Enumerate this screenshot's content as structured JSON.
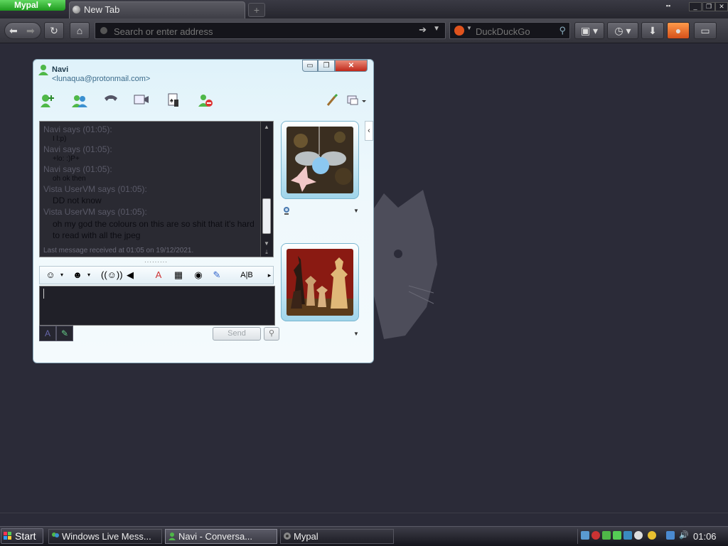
{
  "browser": {
    "app_menu_label": "Mypal",
    "tab_title": "New Tab",
    "new_tab_symbol": "+",
    "address_placeholder": "Search or enter address",
    "search_engine": "DuckDuckGo",
    "icons": [
      "back-icon",
      "forward-icon",
      "reload-icon",
      "home-icon",
      "bookmarks-icon",
      "history-icon",
      "download-icon",
      "firefox-icon",
      "addon-icon"
    ]
  },
  "messenger": {
    "contact_name": "Navi",
    "contact_email": "<lunaqua@protonmail.com>",
    "action_icons": [
      "add-contact-icon",
      "invite-icon",
      "call-icon",
      "video-icon",
      "games-icon",
      "block-icon",
      "paint-icon",
      "display-options-icon"
    ],
    "conversation": [
      {
        "sender": "Navi says (01:05):",
        "text": "I l:p)",
        "small": true
      },
      {
        "sender": "Navi says (01:05):",
        "text": "+lo: :)P+",
        "small": true
      },
      {
        "sender": "Navi says (01:05):",
        "text": "oh ok then",
        "small": true
      },
      {
        "sender": "Vista UserVM says (01:05):",
        "text": "DD not know",
        "small": false
      },
      {
        "sender": "Vista UserVM says (01:05):",
        "text": "oh my god the colours on this are so shit that it's hard to read with all the jpeg",
        "small": false
      }
    ],
    "last_message_status": "Last message received at 01:05 on 19/12/2021.",
    "format_icons": [
      "emoticon-icon",
      "wink-icon",
      "nudge-icon",
      "voice-clip-icon",
      "font-icon",
      "background-icon",
      "ink-icon",
      "handwriting-icon",
      "translate-icon"
    ],
    "input_value": "",
    "send_label": "Send",
    "colors": {
      "accent": "#7ab6d0",
      "close": "#c0281a"
    }
  },
  "taskbar": {
    "start_label": "Start",
    "tasks": [
      {
        "label": "Windows Live Mess..."
      },
      {
        "label": "Navi - Conversa..."
      },
      {
        "label": "Mypal"
      }
    ],
    "clock": "01:06"
  }
}
